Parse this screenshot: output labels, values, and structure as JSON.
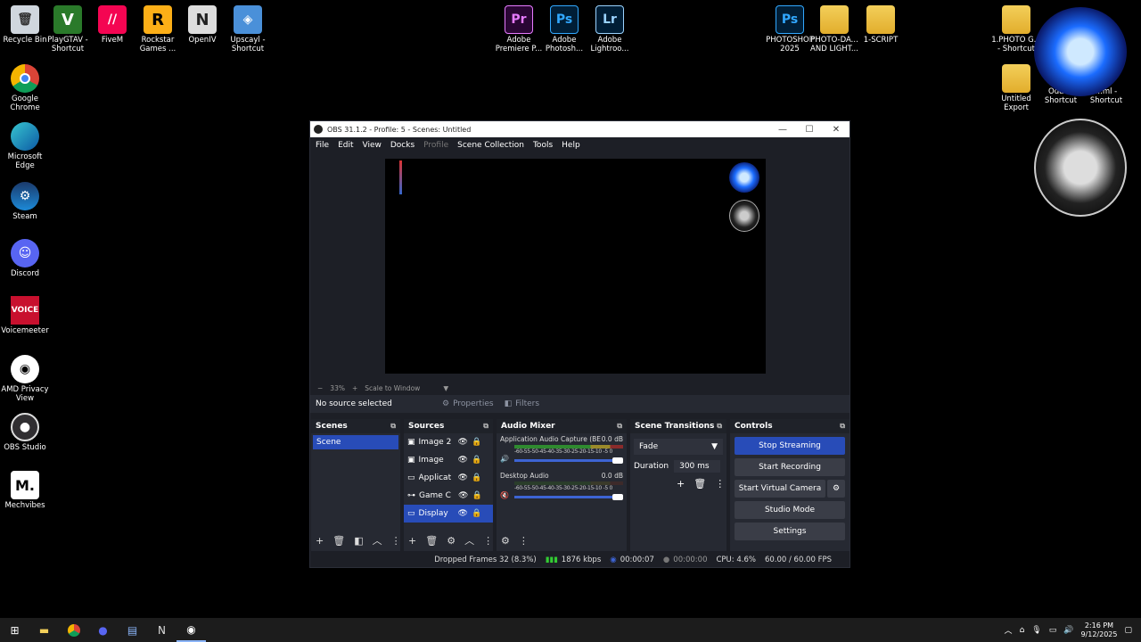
{
  "desktop": {
    "left_icons": [
      {
        "label": "Recycle Bin"
      },
      {
        "label": "Google Chrome"
      },
      {
        "label": "Microsoft Edge"
      },
      {
        "label": "Steam"
      },
      {
        "label": "Discord"
      },
      {
        "label": "Voicemeeter",
        "glyph": "VOICE"
      },
      {
        "label": "AMD Privacy View"
      },
      {
        "label": "OBS Studio"
      },
      {
        "label": "Mechvibes",
        "glyph": "M."
      }
    ],
    "top_icons": [
      {
        "label": "PlayGTAV - Shortcut",
        "glyph": "V"
      },
      {
        "label": "FiveM",
        "glyph": "//"
      },
      {
        "label": "Rockstar Games ...",
        "glyph": "R"
      },
      {
        "label": "OpenIV",
        "glyph": "N"
      },
      {
        "label": "Upscayl - Shortcut",
        "glyph": "◈"
      },
      {
        "label": "Adobe Premiere P...",
        "glyph": "Pr"
      },
      {
        "label": "Adobe Photosh...",
        "glyph": "Ps"
      },
      {
        "label": "Adobe Lightroo...",
        "glyph": "Lr"
      },
      {
        "label": "PHOTOSHOP 2025",
        "glyph": "Ps"
      },
      {
        "label": "PHOTO-DA... AND LIGHT..."
      },
      {
        "label": "1-SCRIPT"
      },
      {
        "label": "1.PHOTO G... - Shortcut"
      },
      {
        "label": "Untitled Export"
      },
      {
        "label": "Oddi... Shortcut"
      },
      {
        "label": "...ml - Shortcut"
      }
    ]
  },
  "obs": {
    "title": "OBS 31.1.2 - Profile: 5 - Scenes: Untitled",
    "menu": [
      "File",
      "Edit",
      "View",
      "Docks",
      "Profile",
      "Scene Collection",
      "Tools",
      "Help"
    ],
    "zoom": "33%",
    "zoom_mode": "Scale to Window",
    "no_source": "No source selected",
    "properties": "Properties",
    "filters": "Filters",
    "scenes": {
      "title": "Scenes",
      "items": [
        "Scene"
      ]
    },
    "sources": {
      "title": "Sources",
      "items": [
        "Image 2",
        "Image",
        "Applicat",
        "Game C",
        "Display"
      ]
    },
    "mixer": {
      "title": "Audio Mixer",
      "ticks": "-60-55-50-45-40-35-30-25-20-15-10 -5 0",
      "channels": [
        {
          "name": "Application Audio Capture (BE",
          "db": "0.0 dB"
        },
        {
          "name": "Desktop Audio",
          "db": "0.0 dB"
        }
      ]
    },
    "transitions": {
      "title": "Scene Transitions",
      "type": "Fade",
      "duration_label": "Duration",
      "duration": "300 ms"
    },
    "controls": {
      "title": "Controls",
      "buttons": [
        "Stop Streaming",
        "Start Recording",
        "Start Virtual Camera",
        "Studio Mode",
        "Settings"
      ]
    },
    "status": {
      "dropped": "Dropped Frames 32 (8.3%)",
      "bitrate": "1876 kbps",
      "stream_time": "00:00:07",
      "rec_time": "00:00:00",
      "cpu": "CPU: 4.6%",
      "fps": "60.00 / 60.00 FPS"
    }
  },
  "taskbar": {
    "time": "2:16 PM",
    "date": "9/12/2025"
  },
  "colors": {
    "accent": "#284cb8",
    "obs_bg": "#1d1f26",
    "dock_bg": "#262932"
  }
}
